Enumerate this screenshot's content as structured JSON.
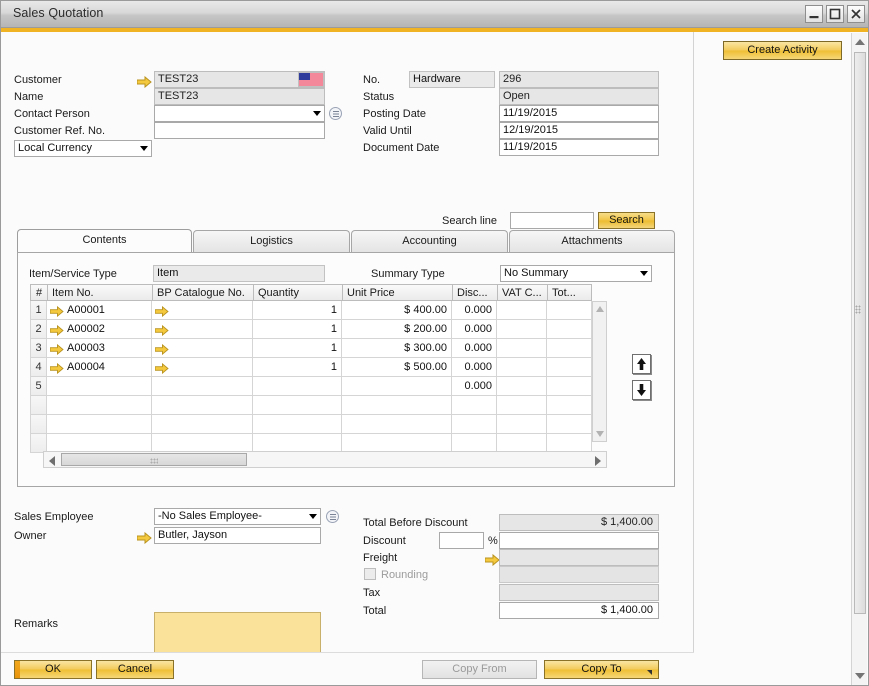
{
  "window": {
    "title": "Sales Quotation",
    "controls": {
      "minimize": "minimize-icon",
      "maximize": "maximize-icon",
      "close": "close-icon"
    },
    "accent_color": "#f0b323"
  },
  "header_left": {
    "customer": {
      "label": "Customer",
      "value": "TEST23",
      "link_icon": "yellow-arrow-icon",
      "flag_icon": "us-flag-icon"
    },
    "name": {
      "label": "Name",
      "value": "TEST23"
    },
    "contact_person": {
      "label": "Contact Person",
      "value": "",
      "menu_icon": "list-menu-icon"
    },
    "customer_ref_no": {
      "label": "Customer Ref. No.",
      "value": ""
    },
    "currency": {
      "value": "Local Currency",
      "options": [
        "Local Currency"
      ]
    }
  },
  "header_right": {
    "no": {
      "label": "No.",
      "series": "Hardware",
      "value": "296"
    },
    "status": {
      "label": "Status",
      "value": "Open"
    },
    "posting_date": {
      "label": "Posting Date",
      "value": "11/19/2015"
    },
    "valid_until": {
      "label": "Valid Until",
      "value": "12/19/2015"
    },
    "document_date": {
      "label": "Document Date",
      "value": "11/19/2015"
    }
  },
  "search": {
    "label": "Search line",
    "value": "",
    "button_label": "Search"
  },
  "tabs": [
    {
      "label": "Contents",
      "active": true
    },
    {
      "label": "Logistics",
      "active": false
    },
    {
      "label": "Accounting",
      "active": false
    },
    {
      "label": "Attachments",
      "active": false
    }
  ],
  "contents": {
    "item_service_type": {
      "label": "Item/Service Type",
      "value": "Item"
    },
    "summary_type": {
      "label": "Summary Type",
      "value": "No Summary",
      "options": [
        "No Summary"
      ]
    }
  },
  "grid": {
    "columns": [
      "#",
      "Item No.",
      "BP Catalogue No.",
      "Quantity",
      "Unit Price",
      "Disc...",
      "VAT C...",
      "Tot..."
    ],
    "rows": [
      {
        "num": "1",
        "item_no": "A00001",
        "bp_catalogue_no": "",
        "quantity": "1",
        "unit_price": "$ 400.00",
        "discount": "0.000",
        "vat_code": "",
        "total": "",
        "has_link": true
      },
      {
        "num": "2",
        "item_no": "A00002",
        "bp_catalogue_no": "",
        "quantity": "1",
        "unit_price": "$ 200.00",
        "discount": "0.000",
        "vat_code": "",
        "total": "",
        "has_link": true
      },
      {
        "num": "3",
        "item_no": "A00003",
        "bp_catalogue_no": "",
        "quantity": "1",
        "unit_price": "$ 300.00",
        "discount": "0.000",
        "vat_code": "",
        "total": "",
        "has_link": true
      },
      {
        "num": "4",
        "item_no": "A00004",
        "bp_catalogue_no": "",
        "quantity": "1",
        "unit_price": "$ 500.00",
        "discount": "0.000",
        "vat_code": "",
        "total": "",
        "has_link": true
      },
      {
        "num": "5",
        "item_no": "",
        "bp_catalogue_no": "",
        "quantity": "",
        "unit_price": "",
        "discount": "0.000",
        "vat_code": "",
        "total": "",
        "has_link": false
      },
      {
        "num": "",
        "item_no": "",
        "bp_catalogue_no": "",
        "quantity": "",
        "unit_price": "",
        "discount": "",
        "vat_code": "",
        "total": "",
        "has_link": false
      },
      {
        "num": "",
        "item_no": "",
        "bp_catalogue_no": "",
        "quantity": "",
        "unit_price": "",
        "discount": "",
        "vat_code": "",
        "total": "",
        "has_link": false
      },
      {
        "num": "",
        "item_no": "",
        "bp_catalogue_no": "",
        "quantity": "",
        "unit_price": "",
        "discount": "",
        "vat_code": "",
        "total": "",
        "has_link": false
      }
    ]
  },
  "footer_left": {
    "sales_employee": {
      "label": "Sales Employee",
      "value": "-No Sales Employee-",
      "menu_icon": "list-menu-icon"
    },
    "owner": {
      "label": "Owner",
      "value": "Butler, Jayson",
      "link_icon": "yellow-arrow-icon"
    },
    "remarks": {
      "label": "Remarks",
      "value": ""
    }
  },
  "totals": {
    "total_before_discount": {
      "label": "Total Before Discount",
      "value": "$ 1,400.00"
    },
    "discount": {
      "label": "Discount",
      "percent_value": "",
      "percent_symbol": "%",
      "amount_value": ""
    },
    "freight": {
      "label": "Freight",
      "value": "",
      "link_icon": "yellow-arrow-icon"
    },
    "rounding": {
      "label": "Rounding",
      "value": "",
      "checked": false
    },
    "tax": {
      "label": "Tax",
      "value": ""
    },
    "total": {
      "label": "Total",
      "value": "$ 1,400.00"
    }
  },
  "buttons": {
    "ok": "OK",
    "cancel": "Cancel",
    "copy_from": "Copy From",
    "copy_to": "Copy To",
    "create_activity": "Create Activity"
  }
}
